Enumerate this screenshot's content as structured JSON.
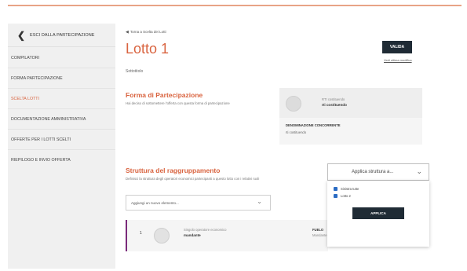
{
  "sidebar": {
    "exit_label": "ESCI DALLA PARTECIPAZIONE",
    "items": [
      {
        "label": "COMPILATORI",
        "active": false
      },
      {
        "label": "FORMA PARTECIPAZIONE",
        "active": false
      },
      {
        "label": "SCELTA LOTTI",
        "active": true
      },
      {
        "label": "DOCUMENTAZIONE AMMINISTRATIVA",
        "active": false
      },
      {
        "label": "OFFERTE PER I LOTTI SCELTI",
        "active": false
      },
      {
        "label": "RIEPILOGO E INVIO OFFERTA",
        "active": false
      }
    ]
  },
  "main": {
    "back_link": "Torna a Scelta dei Lotti",
    "title": "Lotto 1",
    "subtitle": "Sottotitolo",
    "validate_label": "VALIDA",
    "last_edit": "Vedi ultima modifica",
    "participation": {
      "title": "Forma di Partecipazione",
      "subtitle": "Hai deciso di sottomettere l'offerta con questa forma di partecipazione",
      "card": {
        "type_label": "RTI costituendo",
        "type_value": "rti costituendo",
        "name_label": "DENOMINAZIONE CONCORRENTE",
        "name_value": "rti costituendo"
      }
    },
    "grouping": {
      "title": "Struttura del raggruppamento",
      "subtitle": "Definisci la struttura degli operatori economici partecipanti a questo lotto con i relativi ruoli",
      "add_placeholder": "Aggiungi un nuovo elemento...",
      "member": {
        "index": "1",
        "type": "Singolo operatore economico",
        "role": "mandante",
        "right_title": "FUELO",
        "right_sub": "Mandante"
      },
      "apply_label": "Applica struttura a...",
      "options": [
        "Sinistra tutte",
        "Lotto 2"
      ],
      "apply_button": "APPLICA"
    }
  },
  "colors": {
    "accent": "#d9633f",
    "dark_button": "#1f2b35",
    "checkbox": "#2b6cc4",
    "member_border": "#7a2a7a",
    "topbar": "#e8a386"
  }
}
